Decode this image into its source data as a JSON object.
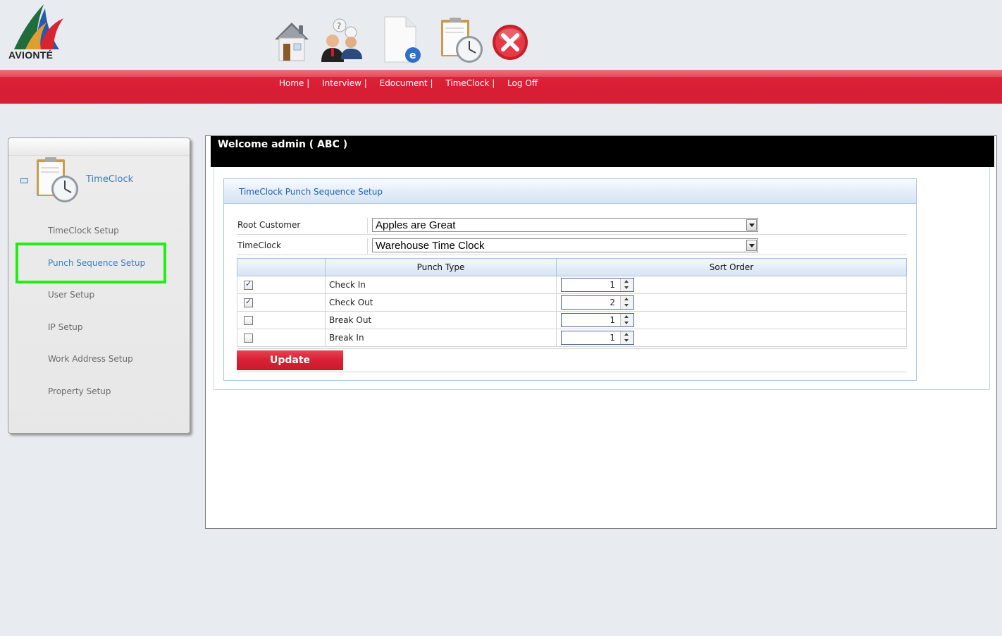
{
  "logo": {
    "text": "AVIONTÉ"
  },
  "top_icons": [
    "home-icon",
    "interview-icon",
    "edocument-icon",
    "timeclock-icon",
    "log-off-icon"
  ],
  "nav": {
    "items": [
      "Home |",
      "Interview |",
      "Edocument |",
      "TimeClock |",
      "Log Off"
    ]
  },
  "sidebar": {
    "section_title": "TimeClock",
    "items": [
      {
        "label": "TimeClock Setup"
      },
      {
        "label": "Punch Sequence Setup",
        "active": true
      },
      {
        "label": "User Setup"
      },
      {
        "label": "IP Setup"
      },
      {
        "label": "Work Address Setup"
      },
      {
        "label": "Property Setup"
      }
    ]
  },
  "welcome": "Welcome admin ( ABC )",
  "panel": {
    "title": "TimeClock Punch Sequence Setup",
    "root_customer_label": "Root Customer",
    "root_customer_value": "Apples are Great",
    "timeclock_label": "TimeClock",
    "timeclock_value": "Warehouse Time Clock",
    "columns": [
      "",
      "Punch Type",
      "Sort Order"
    ],
    "rows": [
      {
        "checked": true,
        "punch_type": "Check In",
        "sort_order": "1"
      },
      {
        "checked": true,
        "punch_type": "Check Out",
        "sort_order": "2"
      },
      {
        "checked": false,
        "punch_type": "Break Out",
        "sort_order": "1"
      },
      {
        "checked": false,
        "punch_type": "Break In",
        "sort_order": "1"
      }
    ],
    "update_label": "Update"
  },
  "colors": {
    "brand_red": "#d81d33",
    "link_blue": "#3d7cc0",
    "highlight_green": "#22ee11"
  }
}
